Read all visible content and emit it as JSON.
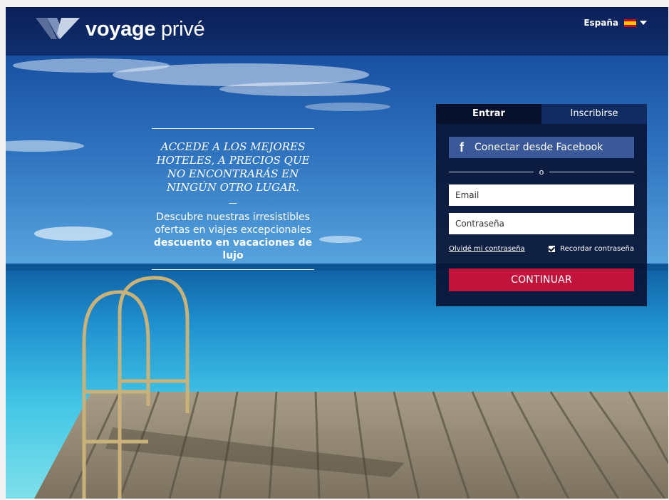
{
  "brand": {
    "name_bold": "voyage",
    "name_light": " privé"
  },
  "header": {
    "country": "España",
    "flag_icon": "spain-flag-icon",
    "dropdown_icon": "chevron-down-icon"
  },
  "promo": {
    "headline": "ACCEDE A LOS MEJORES HOTELES, A PRECIOS QUE NO ENCONTRARÁS EN NINGÚN OTRO LUGAR.",
    "dash": "—",
    "body_prefix": "Descubre nuestras irresistibles ofertas en viajes excepcionales ",
    "body_bold": "descuento en vacaciones de lujo"
  },
  "login": {
    "tabs": [
      {
        "label": "Entrar",
        "active": true
      },
      {
        "label": "Inscribirse",
        "active": false
      }
    ],
    "facebook_icon": "facebook-icon",
    "facebook_label": "Conectar desde Facebook",
    "separator": "o",
    "email_placeholder": "Email",
    "password_placeholder": "Contraseña",
    "forgot_link": "Olvidé mi contraseña",
    "remember_label": "Recordar contraseña",
    "remember_checked": true,
    "continue_label": "CONTINUAR"
  },
  "colors": {
    "header_bg": "#0b1f59",
    "panel_bg": "#081232",
    "facebook": "#3b5998",
    "accent": "#c0143c"
  }
}
